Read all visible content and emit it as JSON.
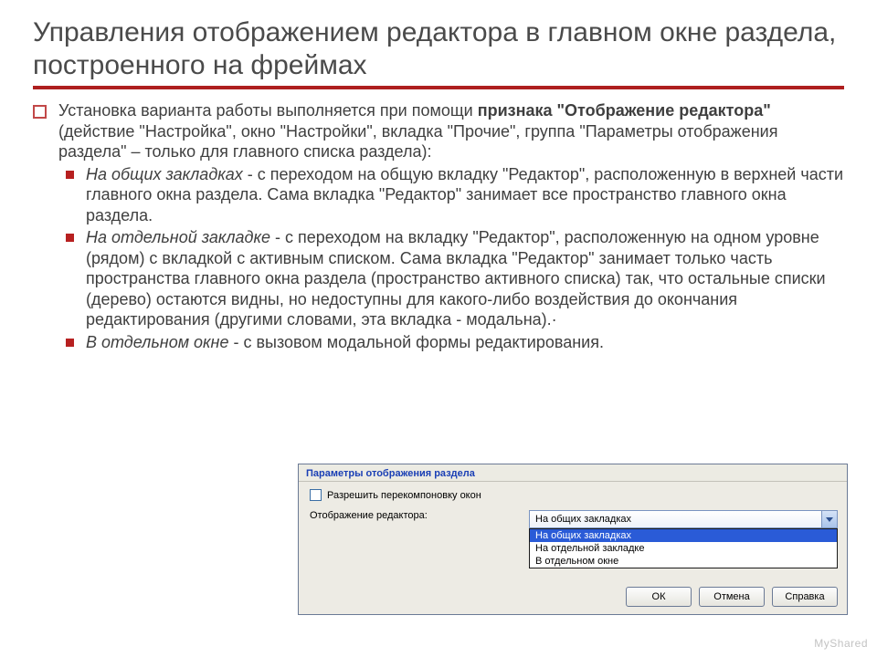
{
  "title": "Управления отображением редактора в главном окне раздела, построенного на фреймах",
  "intro": {
    "pre": "Установка варианта работы выполняется при помощи ",
    "bold": "признака \"Отображение редактора\"",
    "post": " (действие \"Настройка\", окно \"Настройки\", вкладка \"Прочие\", группа \"Параметры отображения раздела\" – только для главного списка раздела):"
  },
  "items": [
    {
      "lead": "На общих закладках",
      "rest": " - с переходом на общую вкладку \"Редактор\", расположенную в верхней части главного окна раздела. Сама вкладка \"Редактор\" занимает все пространство главного окна раздела."
    },
    {
      "lead": "На отдельной закладке",
      "rest": " - с переходом на вкладку \"Редактор\", расположенную на одном уровне (рядом) с вкладкой с активным списком. Сама вкладка \"Редактор\" занимает только часть пространства главного окна раздела (пространство активного списка) так, что остальные списки (дерево) остаются видны, но недоступны для какого-либо воздействия до окончания редактирования (другими словами, эта вкладка - модальна).·"
    },
    {
      "lead": "В отдельном окне",
      "rest": " - с вызовом модальной формы редактирования."
    }
  ],
  "dialog": {
    "group_title": "Параметры отображения раздела",
    "checkbox_label": "Разрешить перекомпоновку окон",
    "field_label": "Отображение редактора:",
    "selected": "На общих закладках",
    "options": [
      "На общих закладках",
      "На отдельной закладке",
      "В отдельном окне"
    ],
    "selected_index": 0,
    "buttons": {
      "ok": "ОК",
      "cancel": "Отмена",
      "help": "Справка"
    }
  },
  "watermark": "MyShared"
}
